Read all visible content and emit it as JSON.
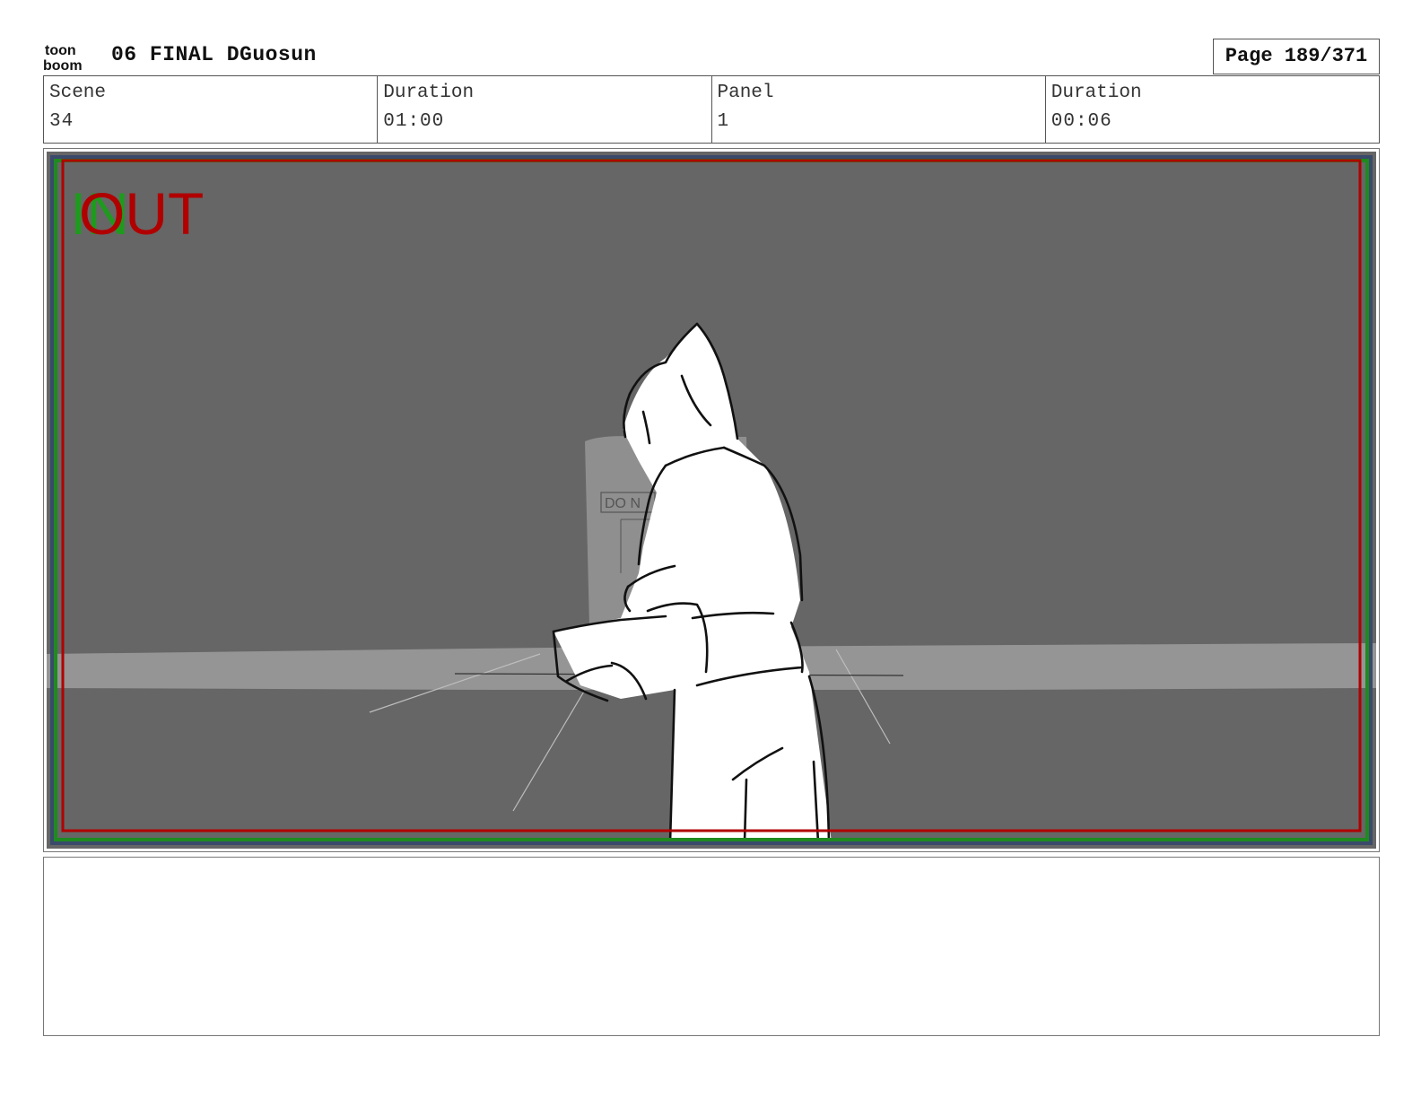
{
  "header": {
    "logo_text_top": "toon",
    "logo_text_bottom": "boom",
    "title": "06 FINAL DGuosun",
    "page": "Page 189/371"
  },
  "info": {
    "scene_label": "Scene",
    "scene_value": "34",
    "scene_duration_label": "Duration",
    "scene_duration_value": "01:00",
    "panel_label": "Panel",
    "panel_value": "1",
    "panel_duration_label": "Duration",
    "panel_duration_value": "00:06"
  },
  "panel": {
    "in_marker": "IN",
    "out_marker": "OUT",
    "sign_text": "DO N",
    "colors": {
      "background": "#666666",
      "floor_band": "#959595",
      "safe_green": "#1f8a1f",
      "safe_red": "#b00000",
      "frame_blue": "#3a4a6a"
    }
  },
  "notes": {
    "text": ""
  }
}
